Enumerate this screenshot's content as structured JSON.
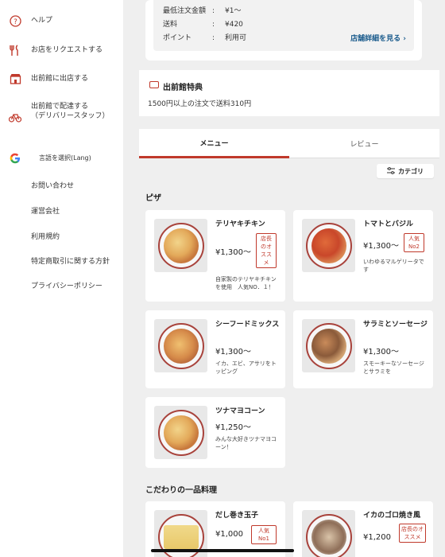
{
  "sidebar": {
    "items": [
      {
        "label": "ヘルプ",
        "icon": "help-circle-icon"
      },
      {
        "label": "お店をリクエストする",
        "icon": "fork-knife-icon"
      },
      {
        "label": "出前館に出店する",
        "icon": "store-icon"
      },
      {
        "label": "出前館で配達する\n（デリバリースタッフ）",
        "icon": "bicycle-icon"
      },
      {
        "label": "言語を選択(Lang)",
        "icon": "google-icon"
      }
    ],
    "links": [
      "お問い合わせ",
      "運営会社",
      "利用規約",
      "特定商取引に関する方針",
      "プライバシーポリシー"
    ]
  },
  "shop_info": {
    "rows": [
      {
        "key": "最低注文金額",
        "value": "¥1～"
      },
      {
        "key": "送料",
        "value": "¥420"
      },
      {
        "key": "ポイント",
        "value": "利用可"
      }
    ],
    "detail_link": "店舗詳細を見る"
  },
  "bonus": {
    "title": "出前館特典",
    "text": "1500円以上の注文で送料310円"
  },
  "tabs": {
    "menu": "メニュー",
    "review": "レビュー"
  },
  "category_button": "カテゴリ",
  "sections": [
    {
      "title": "ピザ",
      "items": [
        {
          "name": "テリヤキチキン",
          "price": "¥1,300～",
          "badge": "店長のオススメ",
          "desc": "自家製のテリヤキチキンを使用　人気NO．１！"
        },
        {
          "name": "トマトとバジル",
          "price": "¥1,300～",
          "badge": "人気No2",
          "desc": "いわゆるマルゲリータです"
        },
        {
          "name": "シーフードミックス",
          "price": "¥1,300～",
          "badge": "",
          "desc": "イカ、エビ、アサリをトッピング"
        },
        {
          "name": "サラミとソーセージ",
          "price": "¥1,300～",
          "badge": "",
          "desc": "スモーキーなソーセージとサラミを"
        },
        {
          "name": "ツナマヨコーン",
          "price": "¥1,250～",
          "badge": "",
          "desc": "みんな大好きツナマヨコーン！"
        }
      ]
    },
    {
      "title": "こだわりの一品料理",
      "items": [
        {
          "name": "だし巻き玉子",
          "price": "¥1,000",
          "badge": "人気No1",
          "desc": ""
        },
        {
          "name": "イカのゴロ焼き風",
          "price": "¥1,200",
          "badge": "店長のオススメ",
          "desc": ""
        }
      ]
    }
  ],
  "colors": {
    "accent": "#c0392b",
    "link": "#1a5b8c",
    "background": "#eeeeee"
  }
}
